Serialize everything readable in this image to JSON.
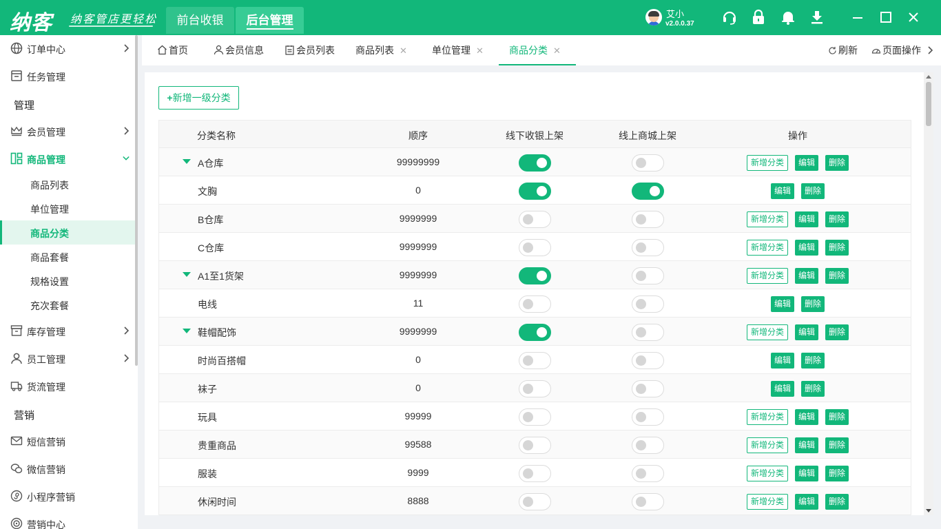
{
  "header": {
    "logo": "纳客",
    "slogan": "纳客管店更轻松",
    "tabs": [
      {
        "label": "前台收银",
        "active": false
      },
      {
        "label": "后台管理",
        "active": true
      }
    ],
    "user_name": "艾小",
    "version": "v2.0.0.37",
    "icons": [
      "headset-icon",
      "lock-icon",
      "bell-icon",
      "download-icon",
      "minimize-icon",
      "maximize-icon",
      "close-icon"
    ]
  },
  "sidebar": {
    "items": [
      {
        "label": "订单中心",
        "icon": "globe-icon",
        "arrow": "right"
      },
      {
        "label": "任务管理",
        "icon": "task-icon"
      },
      {
        "label": "管理",
        "group": true
      },
      {
        "label": "会员管理",
        "icon": "crown-icon",
        "arrow": "right"
      },
      {
        "label": "商品管理",
        "icon": "goods-icon",
        "arrow": "down",
        "open": true
      },
      {
        "label": "库存管理",
        "icon": "inventory-icon",
        "arrow": "right"
      },
      {
        "label": "员工管理",
        "icon": "person-icon",
        "arrow": "right"
      },
      {
        "label": "货流管理",
        "icon": "truck-icon"
      },
      {
        "label": "营销",
        "group": true
      },
      {
        "label": "短信营销",
        "icon": "mail-icon"
      },
      {
        "label": "微信营销",
        "icon": "wechat-icon"
      },
      {
        "label": "小程序营销",
        "icon": "miniprogram-icon"
      },
      {
        "label": "营销中心",
        "icon": "target-icon"
      }
    ],
    "subitems": [
      "商品列表",
      "单位管理",
      "商品分类",
      "商品套餐",
      "规格设置",
      "充次套餐"
    ],
    "active_sub": "商品分类"
  },
  "tabbar": {
    "tabs": [
      {
        "label": "首页",
        "icon": "home-icon",
        "closable": false
      },
      {
        "label": "会员信息",
        "icon": "user-icon",
        "closable": false
      },
      {
        "label": "会员列表",
        "icon": "list-icon",
        "closable": false
      },
      {
        "label": "商品列表",
        "closable": true
      },
      {
        "label": "单位管理",
        "closable": true
      },
      {
        "label": "商品分类",
        "closable": true,
        "active": true
      }
    ],
    "close_glyph": "✕",
    "refresh_label": "刷新",
    "page_ops_label": "页面操作"
  },
  "content": {
    "add_button": "新增一级分类",
    "columns": [
      "分类名称",
      "顺序",
      "线下收银上架",
      "线上商城上架",
      "操作"
    ],
    "op_labels": {
      "add": "新增分类",
      "edit": "编辑",
      "delete": "删除"
    },
    "rows": [
      {
        "name": "A仓库",
        "order": "99999999",
        "offline": true,
        "online": false,
        "caret": true,
        "add": true
      },
      {
        "name": "文胸",
        "order": "0",
        "offline": true,
        "online": true,
        "caret": false,
        "add": false
      },
      {
        "name": "B仓库",
        "order": "9999999",
        "offline": false,
        "online": false,
        "caret": false,
        "add": true
      },
      {
        "name": "C仓库",
        "order": "9999999",
        "offline": false,
        "online": false,
        "caret": false,
        "add": true
      },
      {
        "name": "A1至1货架",
        "order": "9999999",
        "offline": true,
        "online": false,
        "caret": true,
        "add": true
      },
      {
        "name": "电线",
        "order": "11",
        "offline": false,
        "online": false,
        "caret": false,
        "add": false
      },
      {
        "name": "鞋帽配饰",
        "order": "9999999",
        "offline": true,
        "online": false,
        "caret": true,
        "add": true
      },
      {
        "name": "时尚百搭帽",
        "order": "0",
        "offline": false,
        "online": false,
        "caret": false,
        "add": false
      },
      {
        "name": "袜子",
        "order": "0",
        "offline": false,
        "online": false,
        "caret": false,
        "add": false
      },
      {
        "name": "玩具",
        "order": "99999",
        "offline": false,
        "online": false,
        "caret": false,
        "add": true
      },
      {
        "name": "贵重商品",
        "order": "99588",
        "offline": false,
        "online": false,
        "caret": false,
        "add": true
      },
      {
        "name": "服装",
        "order": "9999",
        "offline": false,
        "online": false,
        "caret": false,
        "add": true
      },
      {
        "name": "休闲时间",
        "order": "8888",
        "offline": false,
        "online": false,
        "caret": false,
        "add": true
      }
    ]
  },
  "colors": {
    "brand": "#12b77a",
    "switch_off": "#d6d6d6"
  }
}
